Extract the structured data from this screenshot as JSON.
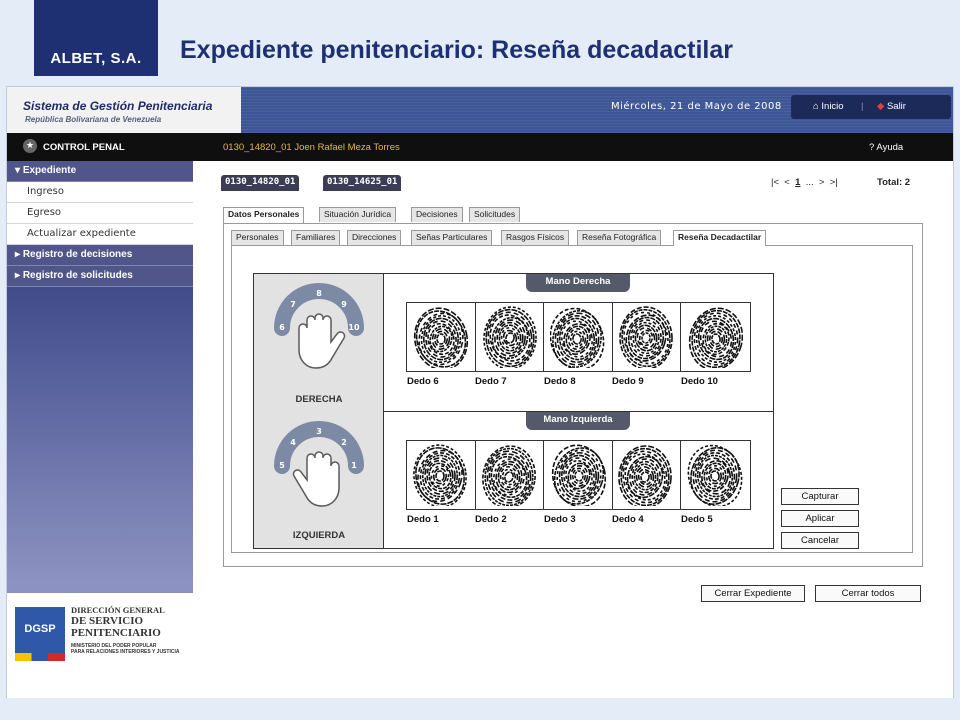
{
  "slide": {
    "brand": "ALBET, S.A.",
    "title": "Expediente penitenciario: Reseña decadactilar"
  },
  "app": {
    "system_title": "Sistema de Gestión Penitenciaria",
    "system_subtitle": "República Bolivariana de Venezuela",
    "date": "Miércoles, 21 de Mayo de 2008",
    "nav_home": "Inicio",
    "nav_exit": "Salir",
    "module": "CONTROL PENAL",
    "case_header": "0130_14820_01 Joen Rafael Meza Torres",
    "help": "Ayuda"
  },
  "sidebar": {
    "section_expediente": "Expediente",
    "items": [
      "Ingreso",
      "Egreso",
      "Actualizar expediente"
    ],
    "section_decisiones": "Registro de decisiones",
    "section_solicitudes": "Registro de solicitudes"
  },
  "dgsp": {
    "acronym": "DGSP",
    "line1": "DIRECCIÓN GENERAL",
    "line2": "DE SERVICIO",
    "line3": "PENITENCIARIO",
    "line4": "MINISTERIO DEL PODER POPULAR",
    "line5": "PARA RELACIONES INTERIORES Y JUSTICIA"
  },
  "case_tabs": [
    "0130_14820_01",
    "0130_14625_01"
  ],
  "pager": {
    "first": "|<",
    "prev": "<",
    "page": "1",
    "ellipsis": "...",
    "next": ">",
    "last": ">|",
    "total": "Total: 2"
  },
  "main_tabs": [
    "Datos Personales",
    "Situación Jurídica",
    "Decisiones",
    "Solicitudes"
  ],
  "sub_tabs": [
    "Personales",
    "Familiares",
    "Direcciones",
    "Señas Particulares",
    "Rasgos Físicos",
    "Reseña Fotográfica",
    "Reseña Decadactilar"
  ],
  "fingerprints": {
    "right_hand_title": "Mano Derecha",
    "left_hand_title": "Mano Izquierda",
    "right_label": "DERECHA",
    "left_label": "IZQUIERDA",
    "right_fingers": [
      "Dedo 6",
      "Dedo 7",
      "Dedo 8",
      "Dedo 9",
      "Dedo 10"
    ],
    "left_fingers": [
      "Dedo 1",
      "Dedo 2",
      "Dedo 3",
      "Dedo 4",
      "Dedo 5"
    ],
    "right_finger_numbers": [
      "6",
      "7",
      "8",
      "9",
      "10"
    ],
    "left_finger_numbers": [
      "5",
      "4",
      "3",
      "2",
      "1"
    ]
  },
  "actions": {
    "capture": "Capturar",
    "apply": "Aplicar",
    "cancel": "Cancelar",
    "close_case": "Cerrar Expediente",
    "close_all": "Cerrar todos"
  }
}
